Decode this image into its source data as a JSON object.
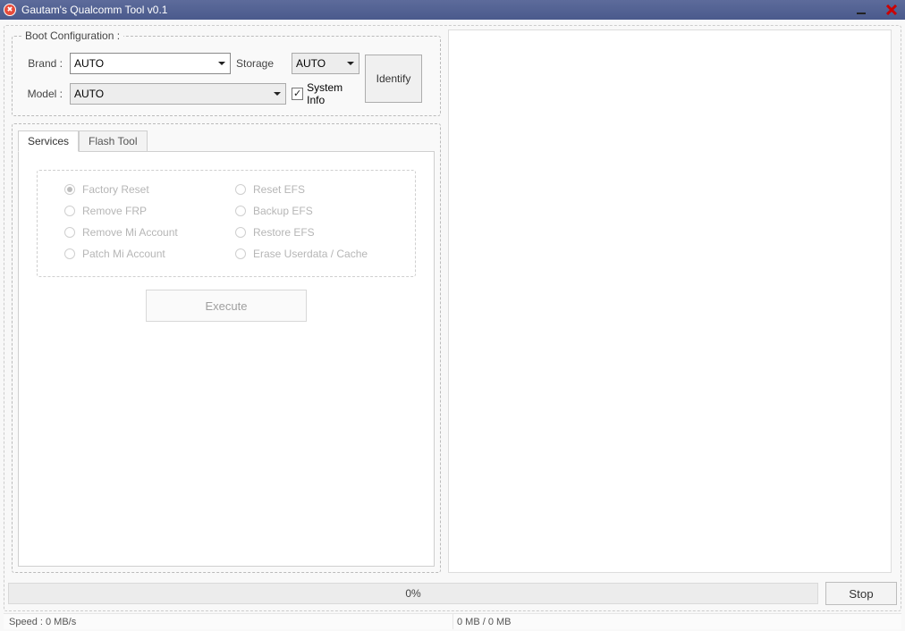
{
  "title": "Gautam's Qualcomm Tool v0.1",
  "boot": {
    "legend": "Boot Configuration :",
    "brand_label": "Brand :",
    "brand_value": "AUTO",
    "model_label": "Model :",
    "model_value": "AUTO",
    "storage_label": "Storage",
    "storage_value": "AUTO",
    "sysinfo_label": "System Info",
    "sysinfo_checked": true,
    "identify_label": "Identify"
  },
  "tabs": [
    {
      "label": "Services",
      "active": true
    },
    {
      "label": "Flash Tool",
      "active": false
    }
  ],
  "services": {
    "options": [
      {
        "label": "Factory Reset",
        "selected": true
      },
      {
        "label": "Reset EFS",
        "selected": false
      },
      {
        "label": "Remove FRP",
        "selected": false
      },
      {
        "label": "Backup EFS",
        "selected": false
      },
      {
        "label": "Remove Mi Account",
        "selected": false
      },
      {
        "label": "Restore EFS",
        "selected": false
      },
      {
        "label": "Patch Mi Account",
        "selected": false
      },
      {
        "label": "Erase Userdata / Cache",
        "selected": false
      }
    ],
    "execute_label": "Execute"
  },
  "progress": {
    "text": "0%",
    "stop_label": "Stop"
  },
  "status": {
    "speed": "Speed : 0 MB/s",
    "bytes": "0 MB / 0 MB"
  }
}
